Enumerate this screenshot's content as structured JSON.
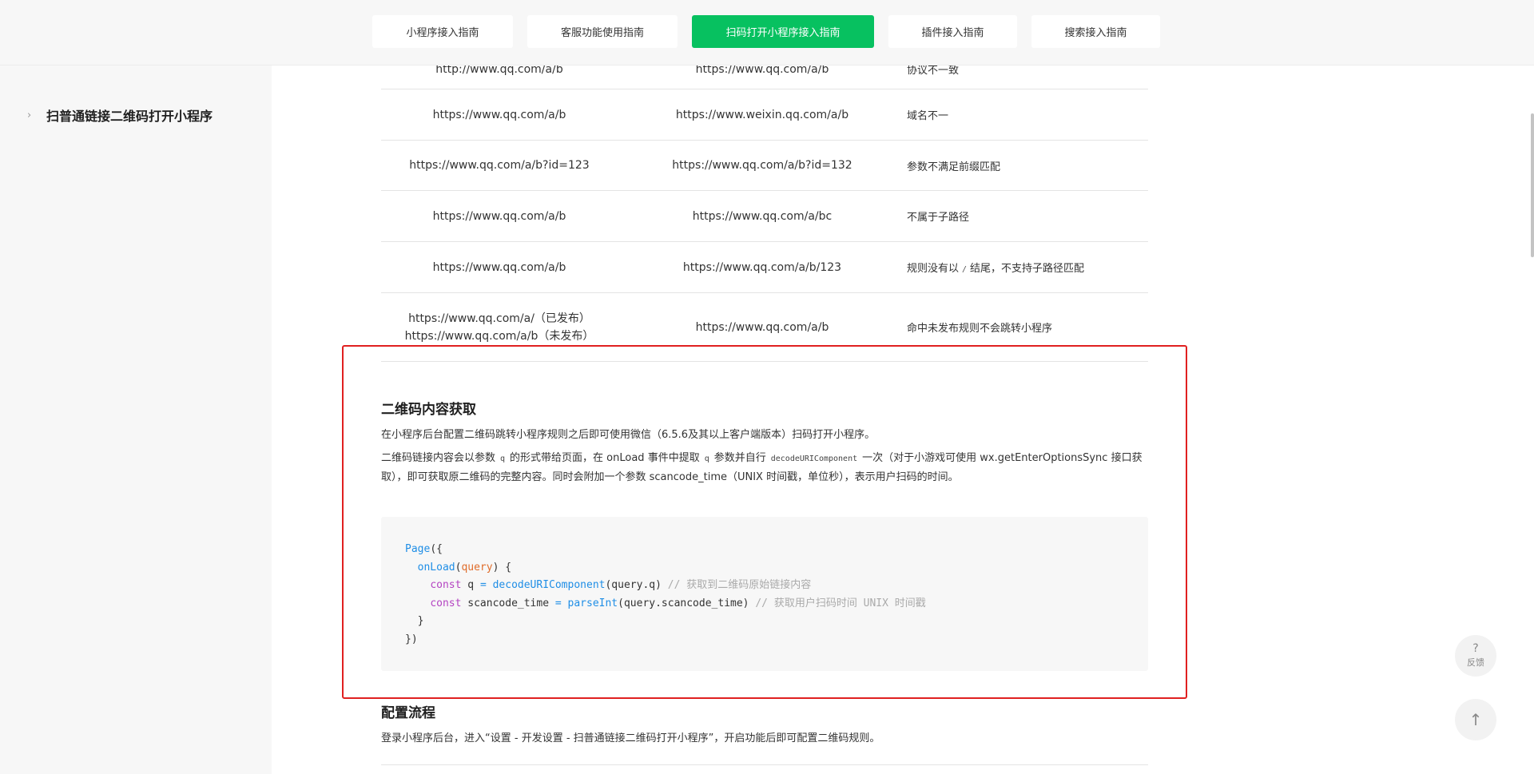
{
  "tabs": [
    {
      "label": "小程序接入指南",
      "active": false
    },
    {
      "label": "客服功能使用指南",
      "active": false
    },
    {
      "label": "扫码打开小程序接入指南",
      "active": true
    },
    {
      "label": "插件接入指南",
      "active": false
    },
    {
      "label": "搜索接入指南",
      "active": false
    }
  ],
  "sidebar": {
    "items": [
      {
        "icon": "chevron-right-icon",
        "chevron": "›",
        "label": "扫普通链接二维码打开小程序"
      }
    ]
  },
  "table": {
    "rows": [
      {
        "c1": "http://www.qq.com/a/b",
        "c2": "https://www.qq.com/a/b",
        "c3": "协议不一致"
      },
      {
        "c1": "https://www.qq.com/a/b",
        "c2": "https://www.weixin.qq.com/a/b",
        "c3": "域名不一"
      },
      {
        "c1": "https://www.qq.com/a/b?id=123",
        "c2": "https://www.qq.com/a/b?id=132",
        "c3": "参数不满足前缀匹配"
      },
      {
        "c1": "https://www.qq.com/a/b",
        "c2": "https://www.qq.com/a/bc",
        "c3": "不属于子路径"
      },
      {
        "c1": "https://www.qq.com/a/b",
        "c2": "https://www.qq.com/a/b/123",
        "c3_pre": "规则没有以",
        "c3_code": "/",
        "c3_post": "结尾，不支持子路径匹配"
      },
      {
        "c1_line1": "https://www.qq.com/a/（已发布）",
        "c1_line2": "https://www.qq.com/a/b（未发布）",
        "c2": "https://www.qq.com/a/b",
        "c3": "命中未发布规则不会跳转小程序"
      }
    ]
  },
  "qr_section": {
    "title": "二维码内容获取",
    "para1": "在小程序后台配置二维码跳转小程序规则之后即可使用微信（6.5.6及其以上客户端版本）扫码打开小程序。",
    "para2": {
      "t1": "二维码链接内容会以参数",
      "code1": "q",
      "t2": "的形式带给页面，在 onLoad 事件中提取",
      "code2": "q",
      "t3": "参数并自行",
      "code3": "decodeURIComponent",
      "t4": "一次（对于小游戏可使用 wx.getEnterOptionsSync 接口获取），即可获取原二维码的完整内容。同时会附加一个参数 scancode_time（UNIX 时间戳，单位秒），表示用户扫码的时间。"
    },
    "code": {
      "l1_fn": "Page",
      "l1_rest": "({",
      "l2_fn": "onLoad",
      "l2_open": "(",
      "l2_param": "query",
      "l2_close": ") {",
      "l3_kw": "const",
      "l3_var": " q ",
      "l3_eq": "=",
      "l3_call": "decodeURIComponent",
      "l3_arg": "(query.q)",
      "l3_cmt": "// 获取到二维码原始链接内容",
      "l4_kw": "const",
      "l4_var": " scancode_time ",
      "l4_eq": "=",
      "l4_call": "parseInt",
      "l4_arg": "(query.scancode_time)",
      "l4_cmt": "// 获取用户扫码时间 UNIX 时间戳",
      "l5": "}",
      "l6": "})"
    }
  },
  "config_section": {
    "title": "配置流程",
    "para": "登录小程序后台，进入“设置 - 开发设置 - 扫普通链接二维码打开小程序”，开启功能后即可配置二维码规则。"
  },
  "float_buttons": {
    "feedback_glyph": "?",
    "feedback_label": "反馈",
    "top_glyph": "↑"
  },
  "colors": {
    "accent": "#07c160",
    "highlight": "#e02020"
  }
}
